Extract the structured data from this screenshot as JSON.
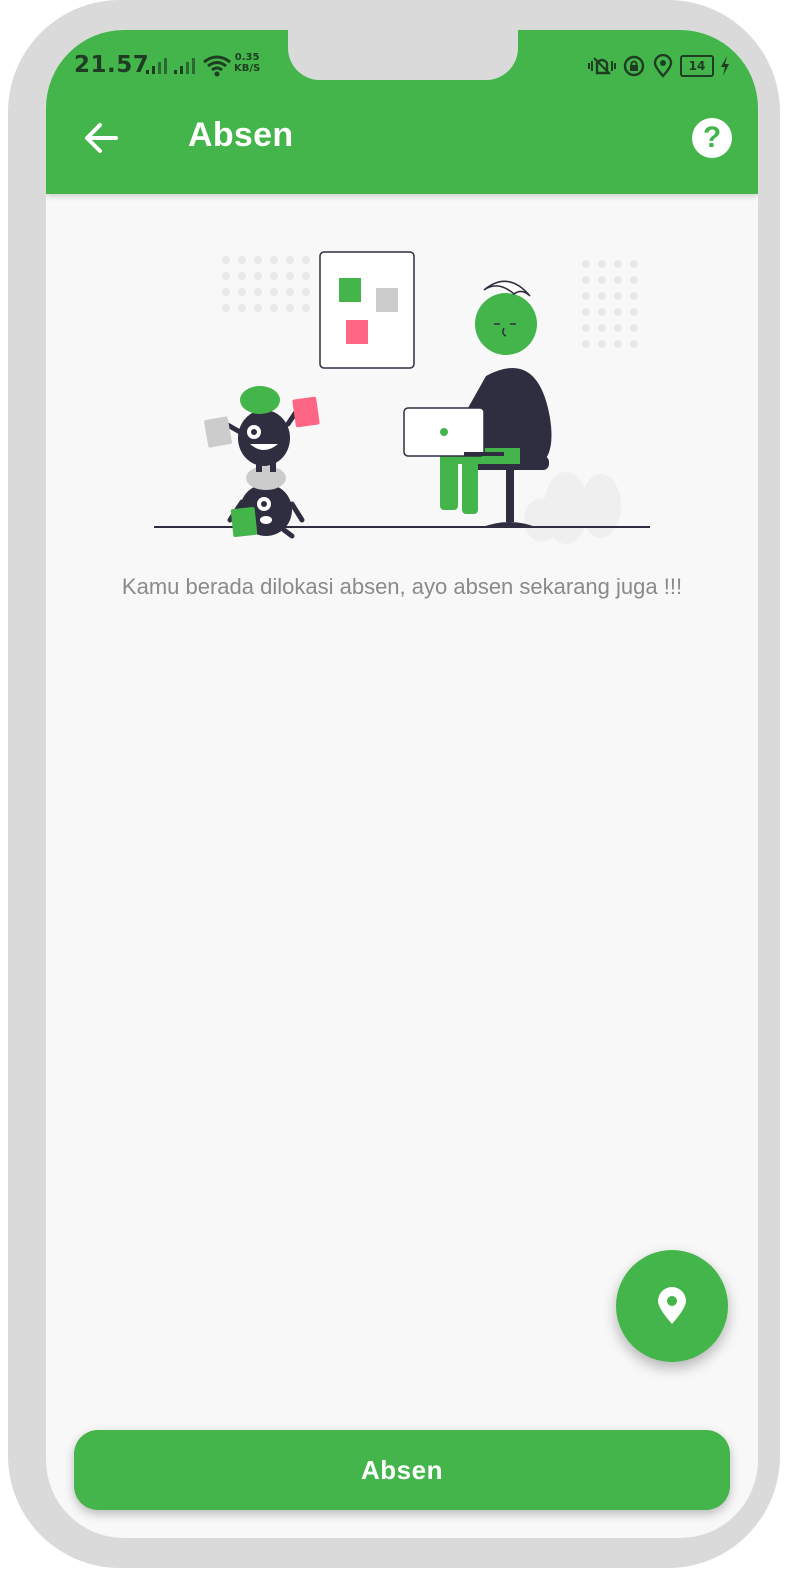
{
  "status_bar": {
    "time": "21.57",
    "net_speed_value": "0.35",
    "net_speed_unit": "KB/S",
    "battery": "14"
  },
  "header": {
    "title": "Absen",
    "back_icon": "arrow-left-icon",
    "help_icon": "question-circle-icon"
  },
  "main": {
    "message": "Kamu berada dilokasi absen, ayo absen sekarang juga !!!"
  },
  "fab": {
    "icon": "location-pin-icon"
  },
  "footer": {
    "submit_label": "Absen"
  },
  "colors": {
    "primary": "#43b54a",
    "dark": "#2f2e41",
    "accent_pink": "#ff6584",
    "background": "#f8f8f8"
  }
}
